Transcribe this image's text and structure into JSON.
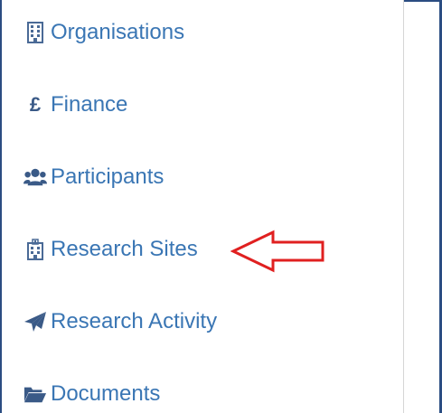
{
  "sidebar": {
    "items": [
      {
        "label": "Organisations",
        "icon": "building-icon"
      },
      {
        "label": "Finance",
        "icon": "pound-icon",
        "glyph": "£"
      },
      {
        "label": "Participants",
        "icon": "users-icon"
      },
      {
        "label": "Research Sites",
        "icon": "hospital-icon"
      },
      {
        "label": "Research Activity",
        "icon": "paper-plane-icon"
      },
      {
        "label": "Documents",
        "icon": "folder-open-icon"
      }
    ]
  },
  "annotation": {
    "type": "arrow",
    "target": "Research Sites",
    "color": "#e02020"
  },
  "colors": {
    "link": "#3a76b4",
    "icon": "#3a5a87",
    "frame": "#2b4d82"
  }
}
